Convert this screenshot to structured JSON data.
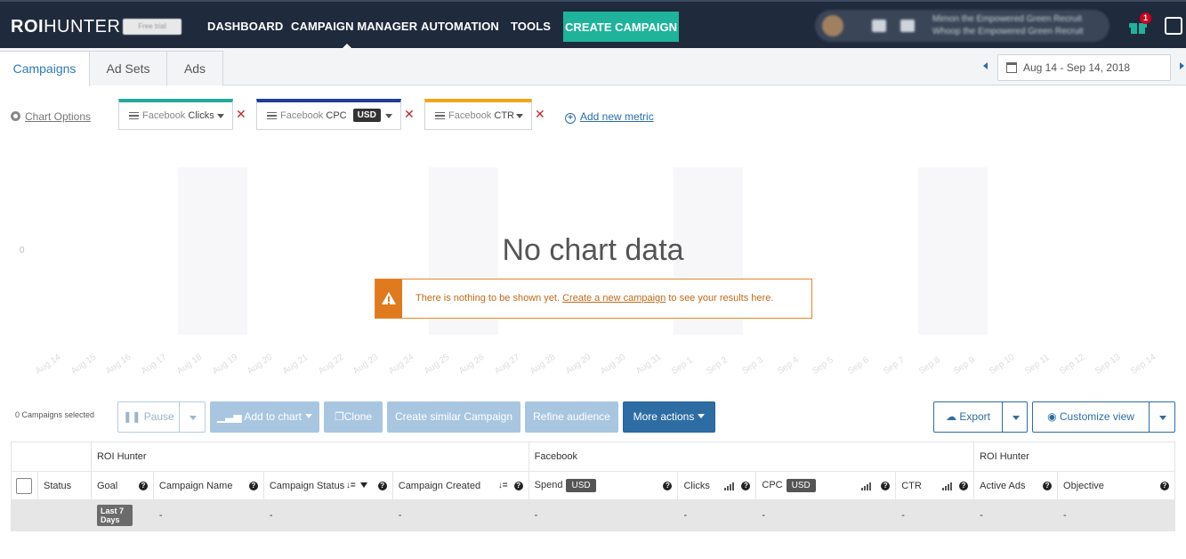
{
  "brand": {
    "logo_bold": "ROI",
    "logo_light": "HUNTER",
    "badge": "Free trial"
  },
  "nav": {
    "items": [
      "DASHBOARD",
      "CAMPAIGN MANAGER",
      "AUTOMATION",
      "TOOLS"
    ],
    "create_label": "CREATE CAMPAIGN",
    "account_line1": "Mimon the Empowered Green Recruit",
    "account_line2": "Whoop the Empowered Green Recruit",
    "gift_count": "1"
  },
  "tabs": [
    "Campaigns",
    "Ad Sets",
    "Ads"
  ],
  "date_range": "Aug 14 - Sep 14, 2018",
  "chart_options_label": "Chart Options",
  "metrics": [
    {
      "prefix": "Facebook",
      "name": "Clicks",
      "color": "#25a99a"
    },
    {
      "prefix": "Facebook",
      "name": "CPC",
      "badge": "USD",
      "color": "#1f3f95"
    },
    {
      "prefix": "Facebook",
      "name": "CTR",
      "color": "#f0a818"
    }
  ],
  "add_metric_label": "Add new metric",
  "chart": {
    "empty_title": "No chart data",
    "y_zero": "0",
    "alert_before": "There is nothing to be shown yet.",
    "alert_link": "Create a new campaign",
    "alert_after": "to see your results here.",
    "x_ticks": [
      "Aug 14",
      "Aug 15",
      "Aug 16",
      "Aug 17",
      "Aug 18",
      "Aug 19",
      "Aug 20",
      "Aug 21",
      "Aug 22",
      "Aug 23",
      "Aug 24",
      "Aug 25",
      "Aug 26",
      "Aug 27",
      "Aug 28",
      "Aug 29",
      "Aug 30",
      "Aug 31",
      "Sep 1",
      "Sep 2",
      "Sep 3",
      "Sep 4",
      "Sep 5",
      "Sep 6",
      "Sep 7",
      "Sep 8",
      "Sep 9",
      "Sep 10",
      "Sep 11",
      "Sep 12",
      "Sep 13",
      "Sep 14"
    ]
  },
  "actions": {
    "selected_count": "0 Campaigns selected",
    "pause": "Pause",
    "add_to_chart": "Add to chart",
    "clone": "Clone",
    "create_similar": "Create similar Campaign",
    "refine": "Refine audience",
    "more": "More actions",
    "export": "Export",
    "customize": "Customize view"
  },
  "table": {
    "groups": [
      "ROI Hunter",
      "Facebook",
      "ROI Hunter"
    ],
    "headers": {
      "status": "Status",
      "goal": "Goal",
      "name": "Campaign Name",
      "campaign_status": "Campaign Status",
      "created": "Campaign Created",
      "spend": "Spend",
      "clicks": "Clicks",
      "cpc": "CPC",
      "ctr": "CTR",
      "active_ads": "Active Ads",
      "objective": "Objective",
      "usd": "USD"
    },
    "row": {
      "goal_badge": "Last 7 Days",
      "dash": "-"
    }
  }
}
